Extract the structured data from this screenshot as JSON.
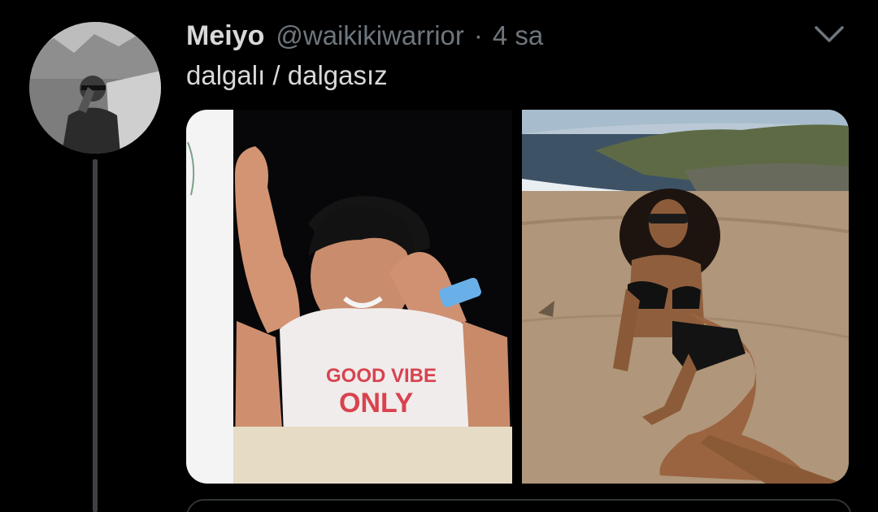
{
  "tweet": {
    "display_name": "Meiyo",
    "handle": "@waikikiwarrior",
    "separator": "·",
    "timestamp": "4 sa",
    "text": "dalgalı / dalgasız",
    "shirt_text_line1": "GOOD VIBE",
    "shirt_text_line2": "ONLY"
  },
  "colors": {
    "background": "#000000",
    "primary_text": "#d9d9d9",
    "secondary_text": "#6e767d",
    "thread_line": "#3d4146"
  },
  "icons": {
    "caret": "chevron-down-icon"
  }
}
